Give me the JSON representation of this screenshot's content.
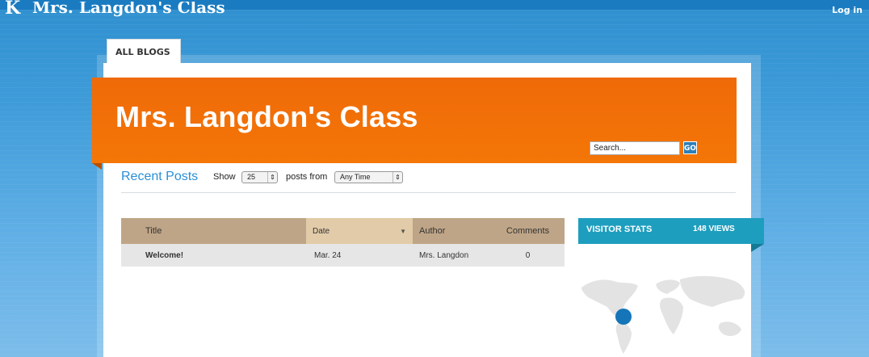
{
  "header": {
    "site_title": "Mrs. Langdon's Class",
    "login_label": "Log in",
    "logo_glyph": "K"
  },
  "tabs": {
    "all_blogs": "ALL BLOGS"
  },
  "banner": {
    "title": "Mrs. Langdon's Class",
    "search_placeholder": "Search...",
    "search_button": "GO",
    "accent_color": "#f06c08"
  },
  "recent_posts": {
    "title": "Recent Posts",
    "show_label": "Show",
    "count_value": "25",
    "posts_from_label": "posts from",
    "time_value": "Any Time"
  },
  "table": {
    "headers": {
      "title": "Title",
      "date": "Date",
      "author": "Author",
      "comments": "Comments"
    },
    "rows": [
      {
        "title": "Welcome!",
        "date": "Mar. 24",
        "author": "Mrs. Langdon",
        "comments": "0"
      }
    ]
  },
  "visitor_stats": {
    "title": "VISITOR STATS",
    "views": "148 VIEWS",
    "header_color": "#1e9ebf"
  },
  "icons": {
    "sort": "chevron-down-icon",
    "select_arrows": "updown-arrows-icon",
    "map_marker": "location-dot-icon"
  }
}
